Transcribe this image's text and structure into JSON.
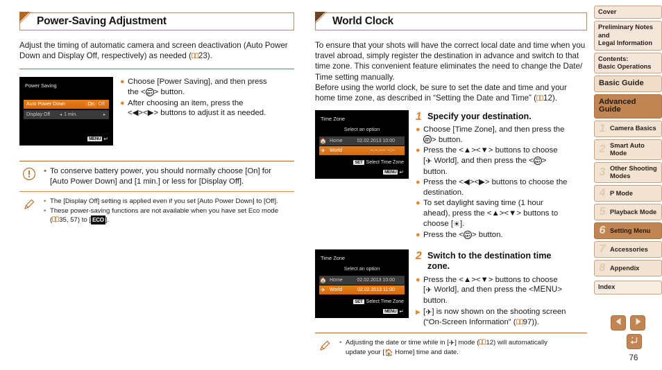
{
  "page_number": "76",
  "colors": {
    "accent_orange": "#e08a33",
    "header_border": "#c08a5a",
    "rule": "#b5651d",
    "nav_fill": "#f2e3d3",
    "nav_active": "#c08552",
    "lcd_select": "#e8801f"
  },
  "left_section": {
    "title": "Power-Saving Adjustment",
    "intro_line1": "Adjust the timing of automatic camera and screen deactivation (Auto Power",
    "intro_line2_a": "Down and Display Off, respectively) as needed (",
    "intro_line2_page": "23).",
    "screen": {
      "title": "Power Saving",
      "row1_label": "Auto Power Down",
      "row1_on": "On",
      "row1_off": "Off",
      "row2_label": "Display Off",
      "row2_value": "1 min.",
      "arrow_left": "◂",
      "arrow_right": "▸",
      "menu_chip": "MENU",
      "return_arrow": "↵"
    },
    "bullets": [
      {
        "pre": "Choose [Power Saving], and then press",
        "post_line_pre": "the <",
        "post_line_post": "> button."
      },
      {
        "pre": "After choosing an item, press the",
        "post_line_pre": "<◀><▶> buttons to adjust it as needed.",
        "post_line_post": ""
      }
    ],
    "caution_note": {
      "icon": "caution-icon",
      "line1": "To conserve battery power, you should normally choose [On] for",
      "line2": "[Auto Power Down] and [1 min.] or less for [Display Off]."
    },
    "pencil_note": {
      "icon": "pencil-icon",
      "item1": "The [Display Off] setting is applied even if you set [Auto Power Down] to [Off].",
      "item2_line1": "These power-saving functions are not available when you have set Eco mode",
      "item2_line2_pages": "35, 57) to [",
      "item2_eco_chip": "ECO",
      "item2_tail": "]."
    }
  },
  "right_section": {
    "title": "World Clock",
    "intro": [
      "To ensure that your shots will have the correct local date and time when you",
      "travel abroad, simply register the destination in advance and switch to that",
      "time zone. This convenient feature eliminates the need to change the Date/",
      "Time setting manually.",
      "Before using the world clock, be sure to set the date and time and your"
    ],
    "intro_last_pre": "home time zone, as described in “Setting the Date and Time” (",
    "intro_last_page": "12).",
    "screen1": {
      "title": "Time Zone",
      "subtitle": "Select an option",
      "home_label": "Home",
      "home_value": "02.02.2013 10:00",
      "world_label": "World",
      "world_value": "--.--.---- --:--",
      "set_chip": "SET",
      "set_text": "Select Time Zone",
      "menu_chip": "MENU",
      "return_arrow": "↵"
    },
    "screen2": {
      "title": "Time Zone",
      "subtitle": "Select an option",
      "home_label": "Home",
      "home_value": "02.02.2013 10:00",
      "world_label": "World",
      "world_value": "02.02.2013 11:00",
      "set_chip": "SET",
      "set_text": "Select Time Zone",
      "menu_chip": "MENU",
      "return_arrow": "↵"
    },
    "step1": {
      "number": "1",
      "title": "Specify your destination.",
      "b1_pre": "Choose [Time Zone], and then press the",
      "b1_post": "> button.",
      "b2_line1": "Press the <▲><▼> buttons to choose",
      "b2_line2_pre": "[",
      "b2_line2_mid": " World], and then press the <",
      "b2_line3": "button.",
      "b3_line1": "Press the <◀><▶> buttons to choose the",
      "b3_line2": "destination.",
      "b4_line1": "To set daylight saving time (1 hour",
      "b4_line2": "ahead), press the <▲><▼> buttons to",
      "b4_line3_pre": "choose [",
      "b4_line3_post": "].",
      "b5_pre": "Press the <",
      "b5_post": "> button."
    },
    "step2": {
      "number": "2",
      "title_line1": "Switch to the destination time",
      "title_line2": "zone.",
      "b1_line1": "Press the <▲><▼> buttons to choose",
      "b1_line2_pre": "[",
      "b1_line2_mid": " World], and then press the <",
      "b1_line2_menu": "MENU",
      "b1_line2_post": ">",
      "b1_line3": "button.",
      "r1_pre": "[",
      "r1_post": "] is now shown on the shooting screen",
      "r2_pre": "(“On-Screen Information” (",
      "r2_page": "97))."
    },
    "pencil_note": {
      "icon": "pencil-icon",
      "line1_pre": "Adjusting the date or time while in [",
      "line1_mid": "] mode (",
      "line1_page": "12) will automatically",
      "line2_pre": "update your [",
      "line2_post": " Home] time and date."
    }
  },
  "sidenav": {
    "items": [
      {
        "label": "Cover",
        "type": "plain"
      },
      {
        "label": "Preliminary Notes and\nLegal Information",
        "type": "plain"
      },
      {
        "label": "Contents:\nBasic Operations",
        "type": "plain"
      },
      {
        "label": "Basic Guide",
        "type": "big"
      },
      {
        "label": "Advanced Guide",
        "type": "big active"
      }
    ],
    "chapters": [
      {
        "num": "1",
        "label": "Camera Basics",
        "active": false
      },
      {
        "num": "2",
        "label": "Smart Auto\nMode",
        "active": false
      },
      {
        "num": "3",
        "label": "Other Shooting\nModes",
        "active": false
      },
      {
        "num": "4",
        "label": "P Mode",
        "active": false
      },
      {
        "num": "5",
        "label": "Playback Mode",
        "active": false
      },
      {
        "num": "6",
        "label": "Setting Menu",
        "active": true
      },
      {
        "num": "7",
        "label": "Accessories",
        "active": false
      },
      {
        "num": "8",
        "label": "Appendix",
        "active": false
      }
    ],
    "index_label": "Index"
  },
  "pagenav": {
    "prev_icon": "triangle-left-icon",
    "next_icon": "triangle-right-icon",
    "back_icon": "return-arrow-icon"
  }
}
